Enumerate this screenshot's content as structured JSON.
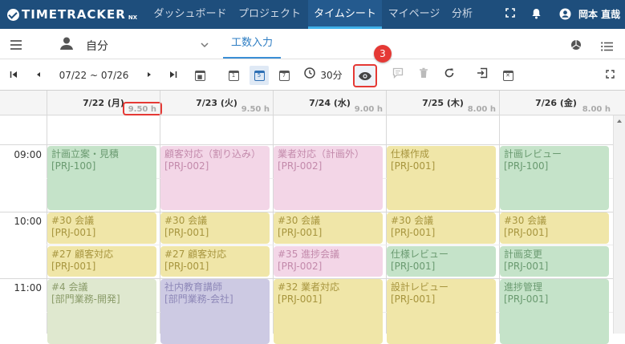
{
  "app": {
    "logo": "TIMETRACKER",
    "logo_suffix": "NX"
  },
  "nav": [
    {
      "label": "ダッシュボード"
    },
    {
      "label": "プロジェクト"
    },
    {
      "label": "タイムシート"
    },
    {
      "label": "マイページ"
    },
    {
      "label": "分析"
    }
  ],
  "user": {
    "name": "岡本 直哉"
  },
  "subbar": {
    "person": "自分",
    "tab": "工数入力"
  },
  "toolbar": {
    "date_range": "07/22 ~ 07/26",
    "interval": "30分"
  },
  "callout": {
    "number": "3"
  },
  "days": [
    {
      "label": "7/22 (月)",
      "hours": "9.50 h"
    },
    {
      "label": "7/23 (火)",
      "hours": "9.50 h"
    },
    {
      "label": "7/24 (水)",
      "hours": "9.00 h"
    },
    {
      "label": "7/25 (木)",
      "hours": "8.00 h"
    },
    {
      "label": "7/26 (金)",
      "hours": "8.00 h"
    }
  ],
  "times": [
    "09:00",
    "10:00",
    "11:00"
  ],
  "events": [
    {
      "day": 0,
      "slot": 0,
      "span": 2,
      "color": "green",
      "title": "計画立案・見積",
      "code": "[PRJ-100]"
    },
    {
      "day": 1,
      "slot": 0,
      "span": 2,
      "color": "pink",
      "title": "顧客対応（割り込み）",
      "code": "[PRJ-002]"
    },
    {
      "day": 2,
      "slot": 0,
      "span": 2,
      "color": "pink",
      "title": "業者対応（計画外）",
      "code": "[PRJ-002]"
    },
    {
      "day": 3,
      "slot": 0,
      "span": 2,
      "color": "yellow",
      "title": "仕様作成",
      "code": "[PRJ-001]"
    },
    {
      "day": 4,
      "slot": 0,
      "span": 2,
      "color": "green",
      "title": "計画レビュー",
      "code": "[PRJ-100]"
    },
    {
      "day": 0,
      "slot": 2,
      "span": 1,
      "color": "yellow",
      "title": "#30 会議",
      "code": "[PRJ-001]"
    },
    {
      "day": 1,
      "slot": 2,
      "span": 1,
      "color": "yellow",
      "title": "#30 会議",
      "code": "[PRJ-001]"
    },
    {
      "day": 2,
      "slot": 2,
      "span": 1,
      "color": "yellow",
      "title": "#30 会議",
      "code": "[PRJ-001]"
    },
    {
      "day": 3,
      "slot": 2,
      "span": 1,
      "color": "yellow",
      "title": "#30 会議",
      "code": "[PRJ-001]"
    },
    {
      "day": 4,
      "slot": 2,
      "span": 1,
      "color": "yellow",
      "title": "#30 会議",
      "code": "[PRJ-001]"
    },
    {
      "day": 0,
      "slot": 3,
      "span": 1,
      "color": "yellow",
      "title": "#27 顧客対応",
      "code": "[PRJ-001]"
    },
    {
      "day": 1,
      "slot": 3,
      "span": 1,
      "color": "yellow",
      "title": "#27 顧客対応",
      "code": "[PRJ-001]"
    },
    {
      "day": 2,
      "slot": 3,
      "span": 1,
      "color": "pink",
      "title": "#35 進捗会議",
      "code": "[PRJ-002]"
    },
    {
      "day": 3,
      "slot": 3,
      "span": 1,
      "color": "green",
      "title": "仕様レビュー",
      "code": "[PRJ-001]"
    },
    {
      "day": 4,
      "slot": 3,
      "span": 1,
      "color": "green",
      "title": "計画変更",
      "code": "[PRJ-001]"
    },
    {
      "day": 0,
      "slot": 4,
      "span": 2,
      "color": "sage",
      "title": "#4 会議",
      "code": "[部門業務-開発]"
    },
    {
      "day": 1,
      "slot": 4,
      "span": 2,
      "color": "purple",
      "title": "社内教育講師",
      "code": "[部門業務-会社]"
    },
    {
      "day": 2,
      "slot": 4,
      "span": 2,
      "color": "yellow",
      "title": "#32 業者対応",
      "code": "[PRJ-001]"
    },
    {
      "day": 3,
      "slot": 4,
      "span": 2,
      "color": "yellow",
      "title": "設計レビュー",
      "code": "[PRJ-001]"
    },
    {
      "day": 4,
      "slot": 4,
      "span": 2,
      "color": "green",
      "title": "進捗管理",
      "code": "[PRJ-001]"
    }
  ]
}
